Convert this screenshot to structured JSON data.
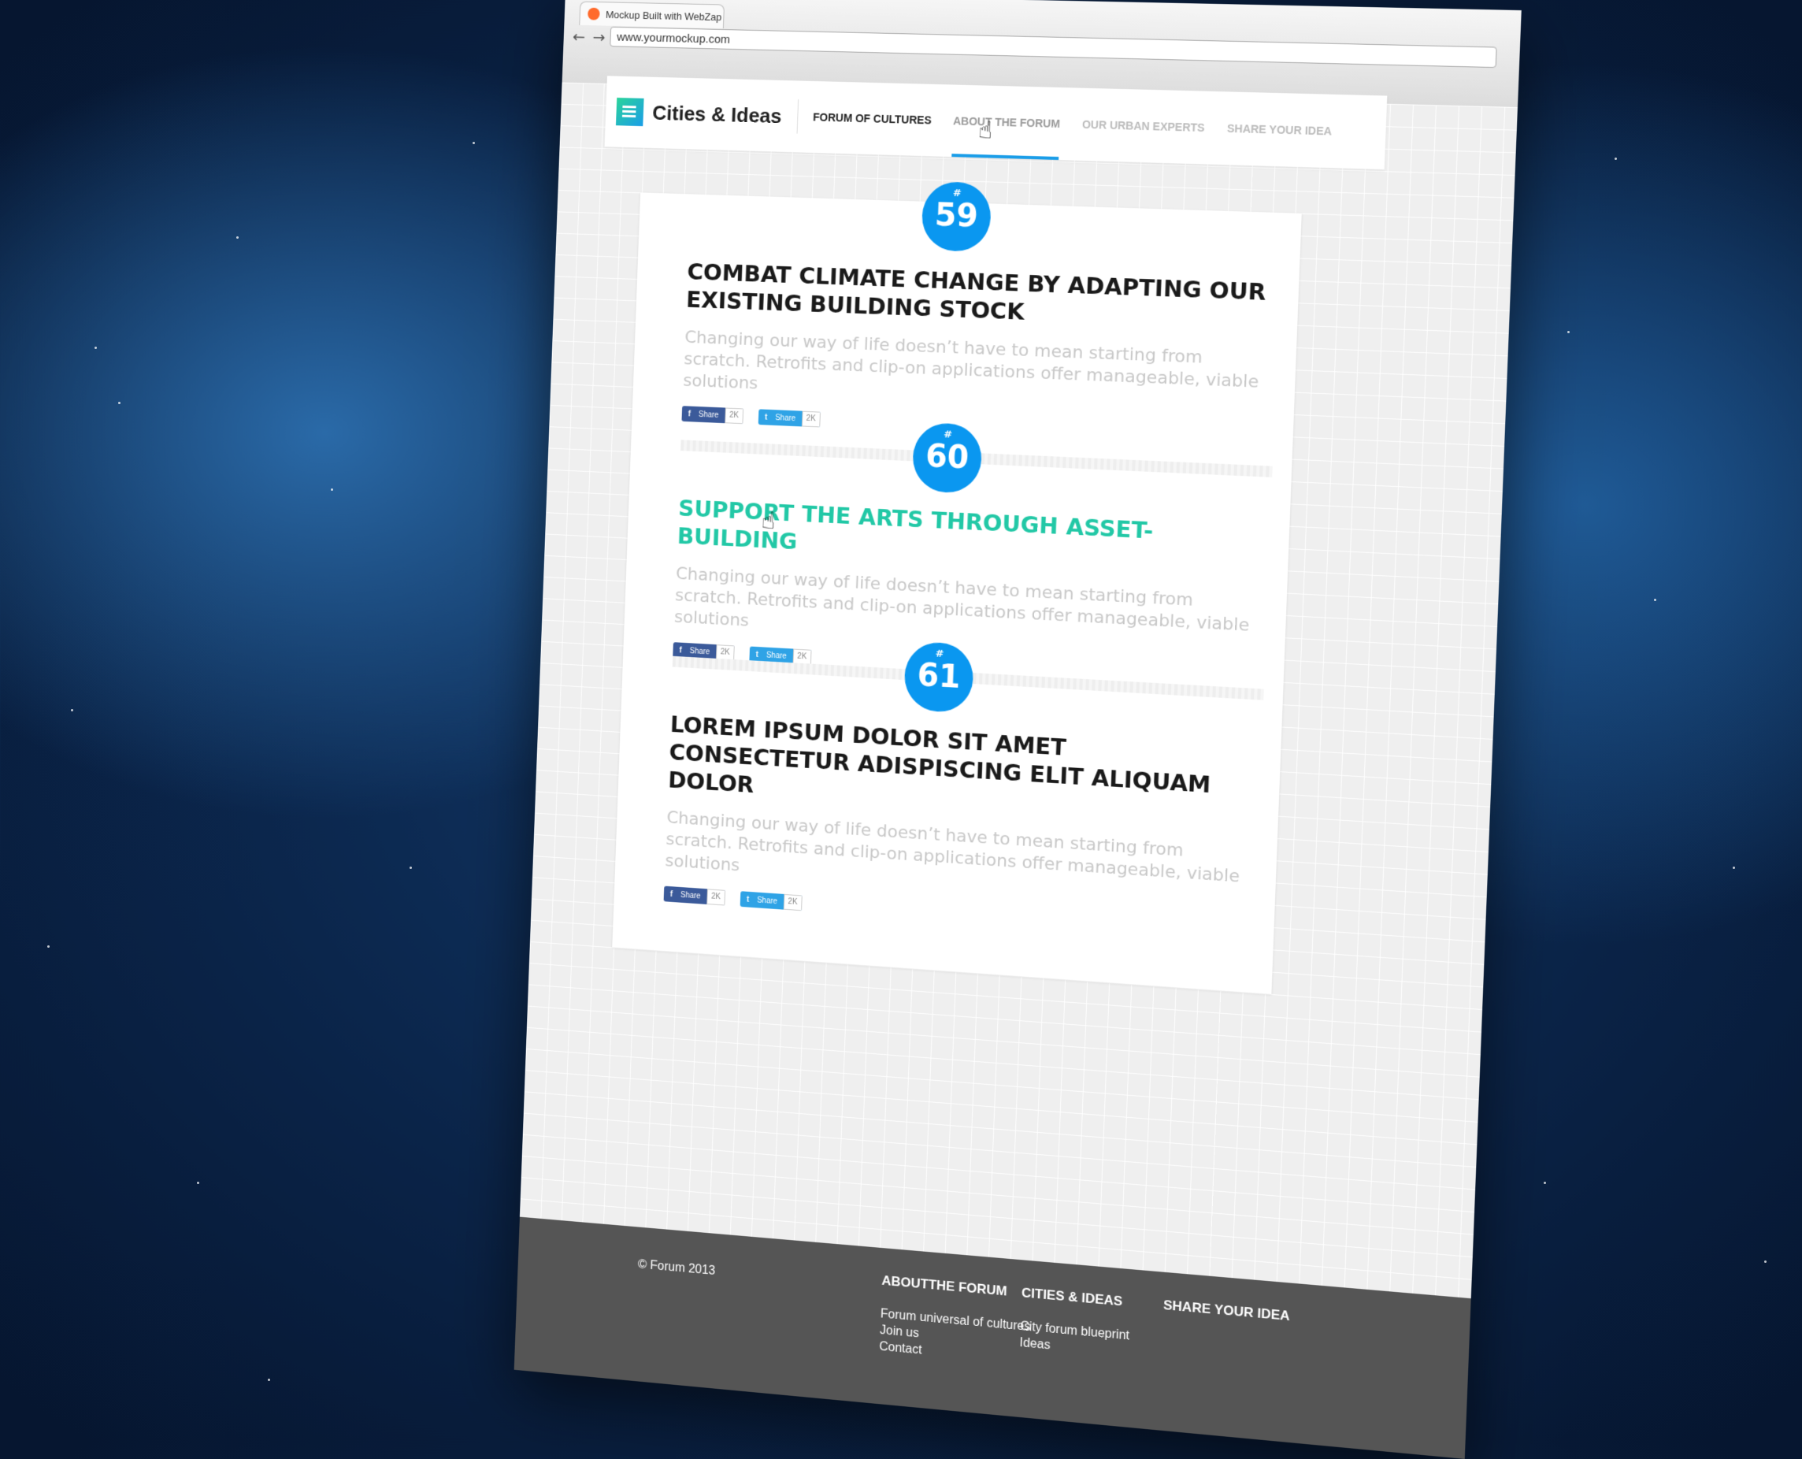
{
  "browser": {
    "tab_title": "Mockup Built with WebZap",
    "url": "www.yourmockup.com",
    "back_label": "←",
    "forward_label": "→"
  },
  "header": {
    "logo_text": "Cities & Ideas",
    "nav": [
      {
        "label": "FORUM OF CULTURES"
      },
      {
        "label": "ABOUT THE FORUM"
      },
      {
        "label": "OUR URBAN EXPERTS"
      },
      {
        "label": "SHARE YOUR IDEA"
      }
    ]
  },
  "items": [
    {
      "hash": "#",
      "number": "59",
      "title": "COMBAT CLIMATE CHANGE BY ADAPTING OUR EXISTING BUILDING STOCK",
      "desc": "Changing our way of life doesn’t have to mean starting from scratch. Retrofits and clip-on applications offer manageable, viable solutions",
      "fb_label": "Share",
      "fb_count": "2K",
      "tw_label": "Share",
      "tw_count": "2K"
    },
    {
      "hash": "#",
      "number": "60",
      "title": "SUPPORT THE ARTS THROUGH ASSET-BUILDING",
      "desc": "Changing our way of life doesn’t have to mean starting from scratch. Retrofits and clip-on applications offer manageable, viable solutions",
      "fb_label": "Share",
      "fb_count": "2K",
      "tw_label": "Share",
      "tw_count": "2K"
    },
    {
      "hash": "#",
      "number": "61",
      "title": "LOREM IPSUM DOLOR SIT AMET CONSECTETUR ADISPISCING ELIT ALIQUAM DOLOR",
      "desc": "Changing our way of life doesn’t have to mean starting from scratch. Retrofits and clip-on applications offer manageable, viable solutions",
      "fb_label": "Share",
      "fb_count": "2K",
      "tw_label": "Share",
      "tw_count": "2K"
    }
  ],
  "footer": {
    "copyright": "© Forum 2013",
    "col1": {
      "title": "ABOUTTHE FORUM",
      "links": [
        "Forum universal of cultures",
        "Join us",
        "Contact"
      ]
    },
    "col2": {
      "title": "CITIES & IDEAS",
      "links": [
        "City forum blueprint",
        "Ideas"
      ]
    },
    "col3": {
      "title": "SHARE YOUR IDEA"
    }
  },
  "colors": {
    "accent": "#0a97f0",
    "highlight_title": "#22c8a6",
    "footer_bg": "#555555",
    "facebook": "#3b5a9a",
    "twitter": "#2fa3e6"
  },
  "icons": {
    "facebook": "f",
    "twitter": "t",
    "cursor": "☝"
  }
}
